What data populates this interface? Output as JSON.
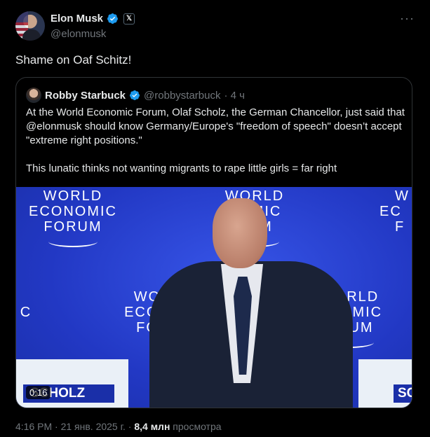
{
  "author": {
    "name": "Elon Musk",
    "handle": "@elonmusk",
    "badge": "𝕏"
  },
  "more_label": "···",
  "tweet_text": "Shame on Oaf Schitz!",
  "quoted": {
    "name": "Robby Starbuck",
    "handle": "@robbystarbuck",
    "time": "· 4 ч",
    "paragraph1": "At the World Economic Forum, Olaf Scholz, the German Chancellor, just said that @elonmusk should know Germany/Europe's \"freedom of speech\" doesn’t accept \"extreme right positions.\"",
    "paragraph2": "This lunatic thinks not wanting migrants to rape little girls = far right",
    "media": {
      "duration": "0:16",
      "backdrop_logo_lines": [
        "WORLD",
        "ECONOMIC",
        "FORUM"
      ],
      "nameplate_text": "SCHOLZ",
      "nameplate_right": "SC",
      "backdrop_partial_1": "W",
      "backdrop_partial_2": "EC",
      "backdrop_partial_3": "F",
      "backdrop_partial_4": "C",
      "logo_mid_top": [
        "WORLD",
        "NOMIC",
        "RUM"
      ],
      "logo_bot_left": [
        "WO",
        "ECON",
        "FO"
      ],
      "logo_bot_right": [
        "WORLD",
        "ONOMIC",
        "ORUM"
      ]
    }
  },
  "footer": {
    "time": "4:16 PM · 21 янв. 2025 г. · ",
    "views": "8,4 млн",
    "views_label": " просмотра"
  },
  "colors": {
    "background": "#000000",
    "text": "#e7e9ea",
    "muted": "#71767b",
    "verified": "#1d9bf0",
    "wef_blue": "#2a43d4"
  }
}
